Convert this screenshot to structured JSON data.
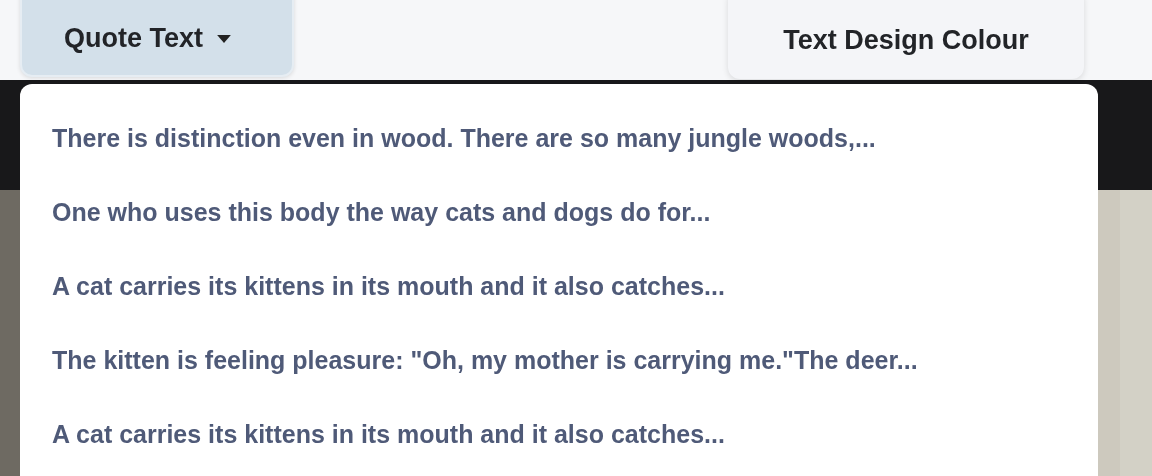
{
  "toolbar": {
    "buttons": [
      {
        "label": "Quote Text",
        "kind": "dropdown",
        "expanded": true
      },
      {
        "label": "Text Design Colour",
        "kind": "plain"
      }
    ]
  },
  "quote_menu": {
    "items": [
      {
        "label": "There is distinction even in wood. There are so many jungle woods,..."
      },
      {
        "label": "One who uses this body the way cats and dogs do for..."
      },
      {
        "label": "A cat carries its kittens in its mouth and it also catches..."
      },
      {
        "label": "The kitten is feeling pleasure: \"Oh, my mother is carrying me.\"The deer..."
      },
      {
        "label": "A cat carries its kittens in its mouth and it also catches..."
      }
    ]
  }
}
